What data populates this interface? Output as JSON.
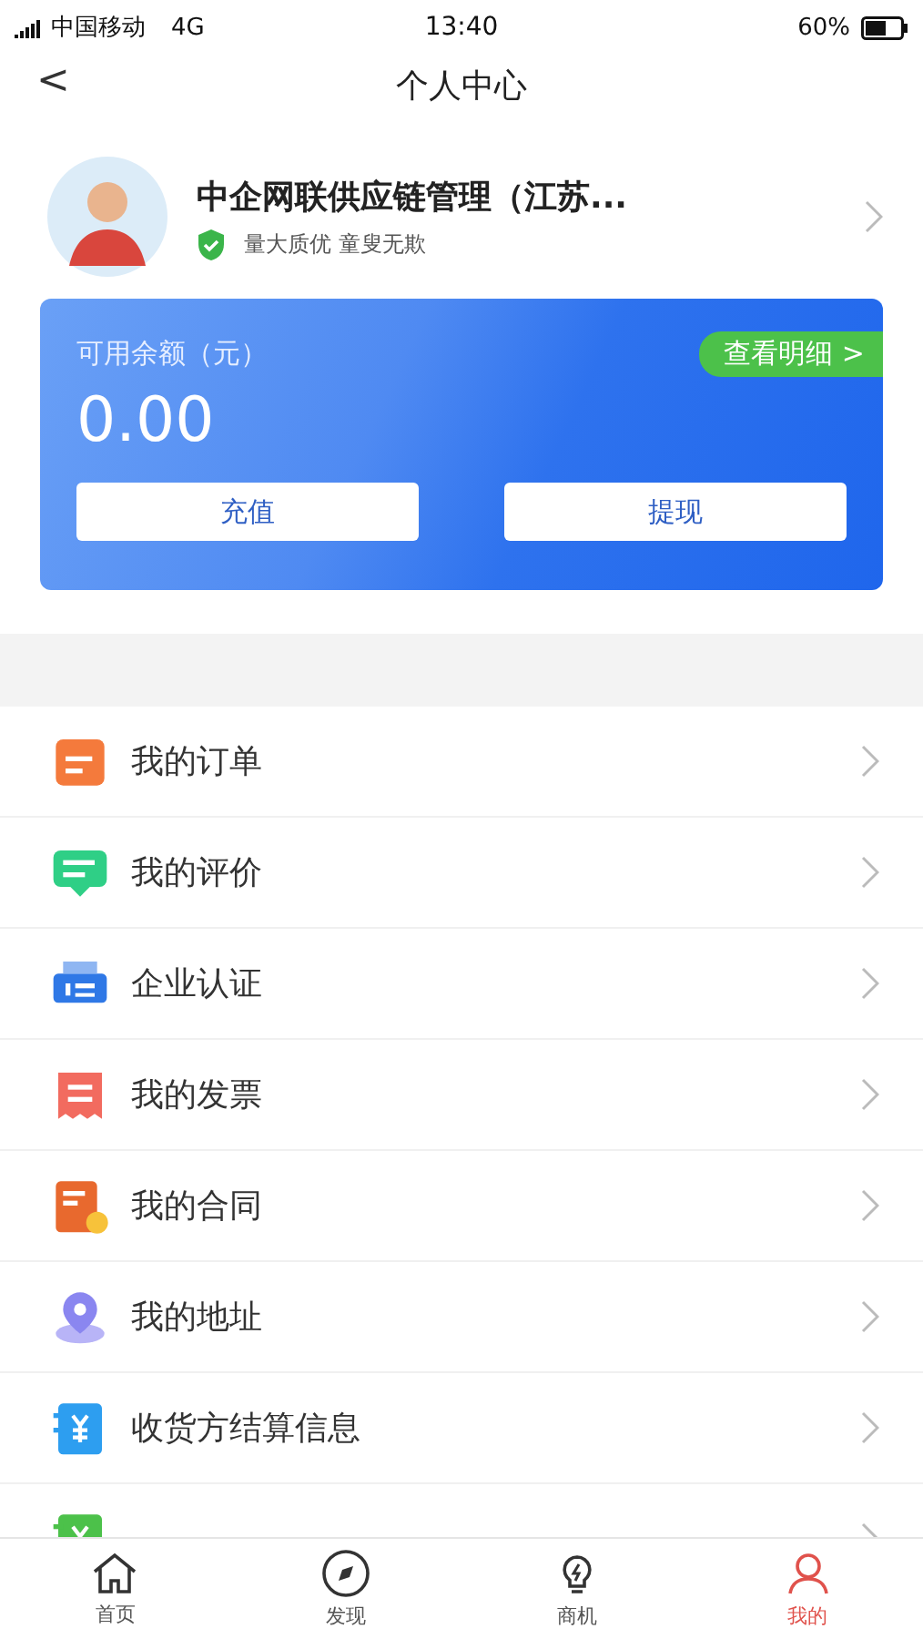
{
  "status_bar": {
    "carrier": "中国移动",
    "network": "4G",
    "time": "13:40",
    "battery": "60%"
  },
  "nav": {
    "back": "<",
    "title": "个人中心"
  },
  "profile": {
    "name": "中企网联供应链管理（江苏...",
    "verified": true,
    "slogan": "量大质优 童叟无欺"
  },
  "wallet": {
    "label": "可用余额（元）",
    "amount": "0.00",
    "detail_link": "查看明细 >",
    "buttons": [
      "充值",
      "提现"
    ]
  },
  "menu": [
    {
      "kind": "order",
      "label": "我的订单"
    },
    {
      "kind": "review",
      "label": "我的评价"
    },
    {
      "kind": "company",
      "label": "企业认证"
    },
    {
      "kind": "invoice",
      "label": "我的发票"
    },
    {
      "kind": "contract",
      "label": "我的合同"
    },
    {
      "kind": "address",
      "label": "我的地址"
    },
    {
      "kind": "receiver",
      "label": "收货方结算信息"
    },
    {
      "kind": "supplier"
    }
  ],
  "tab_bar": [
    {
      "kind": "home",
      "label": "首页",
      "selected": false
    },
    {
      "kind": "discover",
      "label": "发现",
      "selected": false
    },
    {
      "kind": "business",
      "label": "商机",
      "selected": false
    },
    {
      "kind": "mine",
      "label": "我的",
      "selected": true
    }
  ]
}
